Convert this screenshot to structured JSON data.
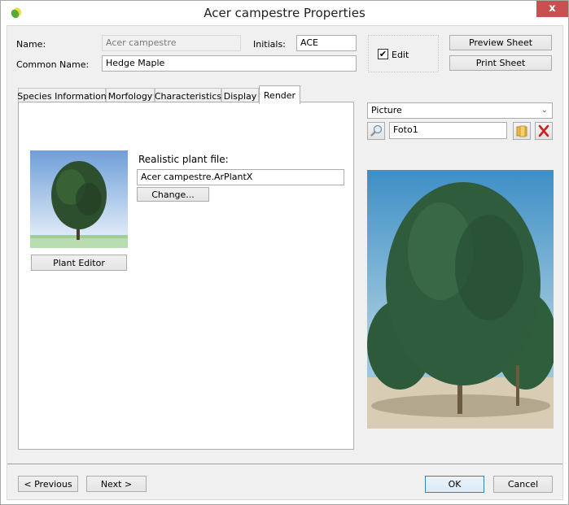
{
  "window": {
    "title": "Acer campestre Properties",
    "close_label": "x"
  },
  "form": {
    "name_label": "Name:",
    "name_value": "Acer campestre",
    "initials_label": "Initials:",
    "initials_value": "ACE",
    "common_name_label": "Common Name:",
    "common_name_value": "Hedge Maple",
    "edit_label": "Edit",
    "edit_checked": true,
    "edit_check_glyph": "✔",
    "preview_sheet_label": "Preview Sheet",
    "print_sheet_label": "Print Sheet"
  },
  "tabs": [
    {
      "label": "Species Information",
      "active": false
    },
    {
      "label": "Morfology",
      "active": false
    },
    {
      "label": "Characteristics",
      "active": false
    },
    {
      "label": "Display",
      "active": false
    },
    {
      "label": "Render",
      "active": true
    }
  ],
  "render_panel": {
    "realistic_file_label": "Realistic plant file:",
    "realistic_file_value": "Acer campestre.ArPlantX",
    "change_button_label": "Change...",
    "plant_editor_button_label": "Plant Editor"
  },
  "picture_panel": {
    "type_selected": "Picture",
    "picture_name": "Foto1",
    "icons": {
      "zoom": "magnifier-icon",
      "browse": "folder-icon",
      "delete": "delete-x-icon"
    }
  },
  "footer": {
    "previous_label": "< Previous",
    "next_label": "Next >",
    "ok_label": "OK",
    "cancel_label": "Cancel"
  },
  "colors": {
    "close_button": "#c75050",
    "delete_icon": "#d22020",
    "default_button_border": "#3c7fb1"
  }
}
